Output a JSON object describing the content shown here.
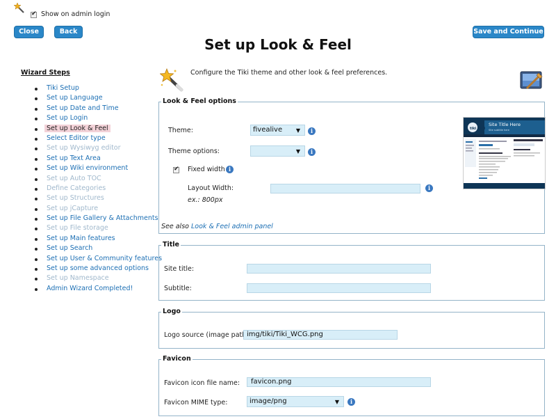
{
  "header": {
    "show_on_login": "Show on admin login",
    "close": "Close",
    "back": "Back",
    "save": "Save and Continue",
    "title": "Set up Look & Feel"
  },
  "sidebar": {
    "title": "Wizard Steps",
    "items": [
      {
        "label": "Tiki Setup",
        "state": "link"
      },
      {
        "label": "Set up Language",
        "state": "link"
      },
      {
        "label": "Set up Date and Time",
        "state": "link"
      },
      {
        "label": "Set up Login",
        "state": "link"
      },
      {
        "label": "Set up Look & Feel",
        "state": "current"
      },
      {
        "label": "Select Editor type",
        "state": "link"
      },
      {
        "label": "Set up Wysiwyg editor",
        "state": "disabled"
      },
      {
        "label": "Set up Text Area",
        "state": "link"
      },
      {
        "label": "Set up Wiki environment",
        "state": "link"
      },
      {
        "label": "Set up Auto TOC",
        "state": "disabled"
      },
      {
        "label": "Define Categories",
        "state": "disabled"
      },
      {
        "label": "Set up Structures",
        "state": "disabled"
      },
      {
        "label": "Set up jCapture",
        "state": "disabled"
      },
      {
        "label": "Set up File Gallery & Attachments",
        "state": "link"
      },
      {
        "label": "Set up File storage",
        "state": "disabled"
      },
      {
        "label": "Set up Main features",
        "state": "link"
      },
      {
        "label": "Set up Search",
        "state": "link"
      },
      {
        "label": "Set up User & Community features",
        "state": "link"
      },
      {
        "label": "Set up some advanced options",
        "state": "link"
      },
      {
        "label": "Set up Namespace",
        "state": "disabled"
      },
      {
        "label": "Admin Wizard Completed!",
        "state": "link"
      }
    ]
  },
  "intro": "Configure the Tiki theme and other look & feel preferences.",
  "look_feel": {
    "legend": "Look & Feel options",
    "theme_label": "Theme:",
    "theme_value": "fivealive",
    "theme_options_label": "Theme options:",
    "theme_options_value": "",
    "fixed_width": "Fixed width",
    "layout_width_label": "Layout Width:",
    "layout_width_value": "",
    "layout_example": "ex.: 800px",
    "see_also": "See also",
    "see_also_link": "Look & Feel admin panel",
    "preview": {
      "site_title": "Site Title Here",
      "site_subtitle": "Site subtitle here",
      "logo_text": "tiki wiki"
    }
  },
  "title_section": {
    "legend": "Title",
    "site_title_label": "Site title:",
    "site_title_value": "",
    "subtitle_label": "Subtitle:",
    "subtitle_value": ""
  },
  "logo_section": {
    "legend": "Logo",
    "source_label": "Logo source (image path):",
    "source_value": "img/tiki/Tiki_WCG.png"
  },
  "favicon_section": {
    "legend": "Favicon",
    "file_label": "Favicon icon file name:",
    "file_value": "favicon.png",
    "mime_label": "Favicon MIME type:",
    "mime_value": "image/png"
  },
  "colors": {
    "button": "#2a87c8",
    "link": "#1c6fb4",
    "input_bg": "#d8eef8",
    "current_step_bg": "#f3d2d8",
    "fieldset_border": "#93b3c8"
  }
}
